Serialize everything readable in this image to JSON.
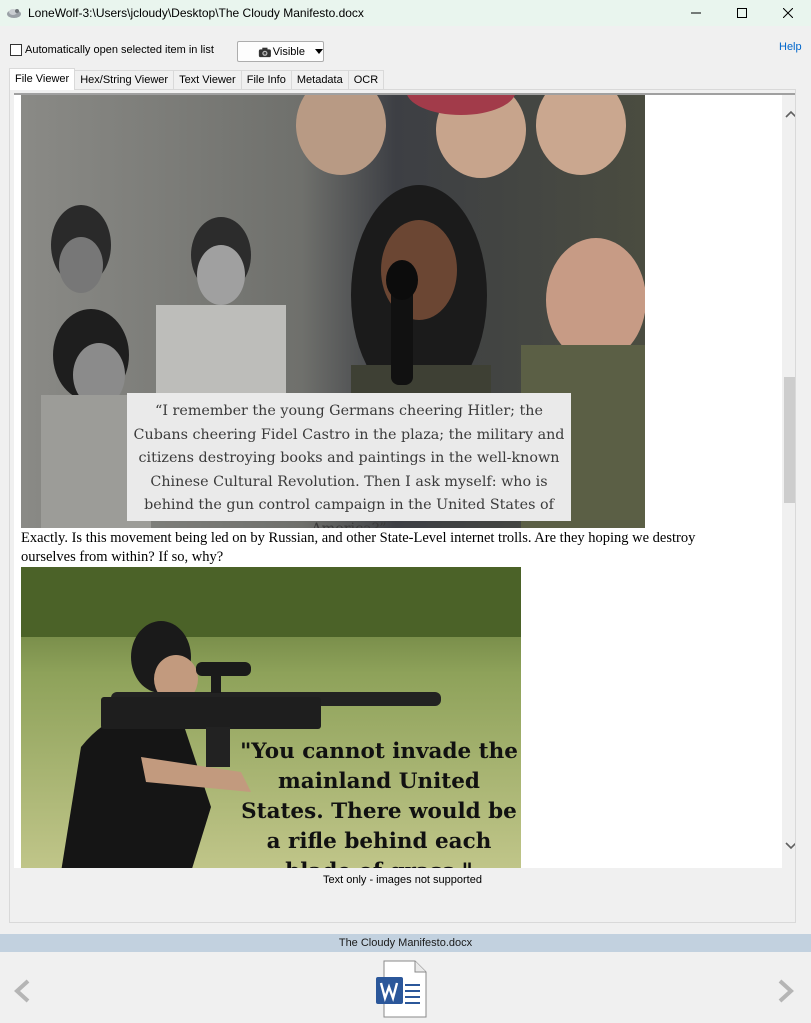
{
  "window": {
    "title": "LoneWolf-3:\\Users\\jcloudy\\Desktop\\The Cloudy Manifesto.docx"
  },
  "options": {
    "auto_open_label": "Automatically open selected item in list",
    "auto_open_checked": false,
    "visibility_label": "Visible",
    "help_label": "Help"
  },
  "tabs": [
    {
      "label": "File Viewer",
      "active": true
    },
    {
      "label": "Hex/String Viewer",
      "active": false
    },
    {
      "label": "Text Viewer",
      "active": false
    },
    {
      "label": "File Info",
      "active": false
    },
    {
      "label": "Metadata",
      "active": false
    },
    {
      "label": "OCR",
      "active": false
    }
  ],
  "document": {
    "image1_quote": "“I remember the young Germans cheering Hitler; the Cubans cheering Fidel Castro in the plaza; the military and citizens destroying books and paintings in the well-known Chinese Cultural Revolution. Then I ask myself: who is behind the gun control campaign in the United States of America?”",
    "paragraph": "Exactly. Is this movement being led on by Russian, and other State-Level internet trolls. Are they hoping we destroy ourselves from within? If so, why?",
    "image2_quote": "\"You cannot invade the mainland United States. There would be a rifle behind each blade of grass.\""
  },
  "status_note": "Text only - images not supported",
  "file_bar": {
    "filename": "The Cloudy Manifesto.docx"
  },
  "colors": {
    "title_bar_bg": "#e9f5ee",
    "file_bar_bg": "#c2d1df",
    "help_link": "#0066cc",
    "word_blue": "#2b579a"
  },
  "icons": {
    "app": "app-icon",
    "camera": "camera-icon",
    "file_type": "word-document-icon"
  }
}
